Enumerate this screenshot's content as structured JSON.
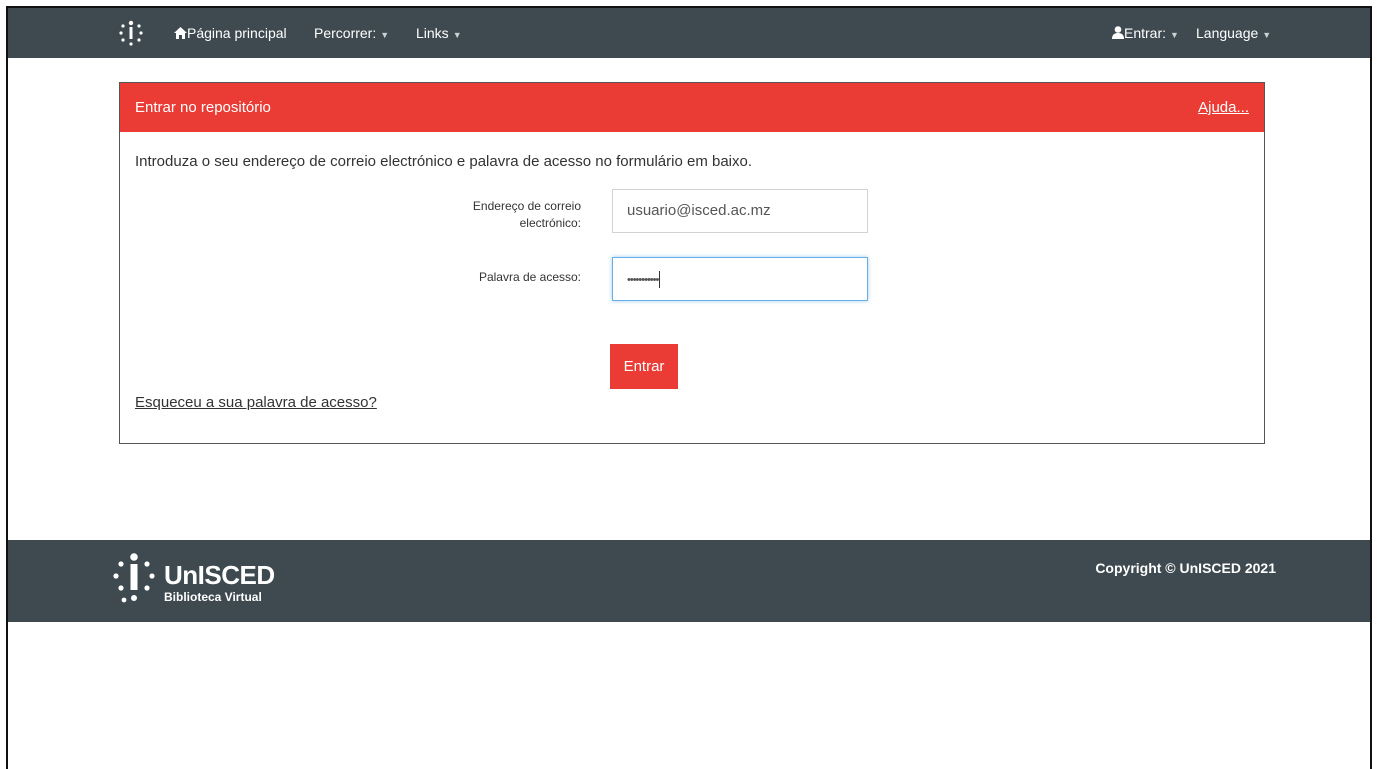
{
  "nav": {
    "home": "Página principal",
    "browse": "Percorrer:",
    "links": "Links",
    "login": "Entrar:",
    "language": "Language"
  },
  "panel": {
    "title": "Entrar no repositório",
    "help": "Ajuda...",
    "intro": "Introduza o seu endereço de correio electrónico e palavra de acesso no formulário em baixo.",
    "email_label_line1": "Endereço de correio",
    "email_label_line2": "electrónico:",
    "email_value": "usuario@isced.ac.mz",
    "password_label": "Palavra de acesso:",
    "password_value": "•••••••••••",
    "submit": "Entrar",
    "forgot": "Esqueceu a sua palavra de acesso?"
  },
  "footer": {
    "brand_name": "UnISCED",
    "brand_sub": "Biblioteca Virtual",
    "copyright": "Copyright © UnISCED 2021"
  },
  "colors": {
    "navbar": "#3e4a50",
    "accent": "#ea3b35",
    "focus": "#66afe9"
  }
}
